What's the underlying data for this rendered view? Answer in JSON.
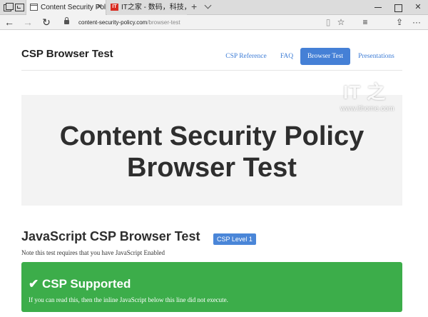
{
  "browser": {
    "tabs": [
      {
        "label": "Content Security Policy",
        "active": true
      },
      {
        "label": "IT之家 - 数码，科技，生活",
        "active": false,
        "favicon_text": "IT"
      }
    ],
    "close_glyph": "✕",
    "new_tab_glyph": "+",
    "address": {
      "domain": "content-security-policy.com",
      "path": "/browser-test"
    },
    "glyphs": {
      "back": "←",
      "forward": "→",
      "refresh": "↻",
      "reading": "▯",
      "star": "☆",
      "hub": "≡",
      "note": "✎",
      "share": "⇪",
      "more": "···",
      "minimize": "",
      "maximize": "",
      "close": "✕"
    }
  },
  "site": {
    "title": "CSP Browser Test",
    "nav": [
      "CSP Reference",
      "FAQ",
      "Browser Test",
      "Presentations"
    ],
    "active_nav": "Browser Test"
  },
  "jumbotron": {
    "title": "Content Security Policy Browser Test"
  },
  "watermark": {
    "logo": "IT 之",
    "url": "www.ithome.com"
  },
  "section": {
    "title": "JavaScript CSP Browser Test",
    "badge": "CSP Level 1",
    "note": "Note this test requires that you have JavaScript Enabled"
  },
  "result": {
    "title": "✔ CSP Supported",
    "text": "If you can read this, then the inline JavaScript below this line did not execute."
  },
  "colors": {
    "accent": "#4580d6",
    "link": "#3e7dd6",
    "success": "#3cad4a",
    "jumbotron_bg": "#f3f3f3"
  }
}
